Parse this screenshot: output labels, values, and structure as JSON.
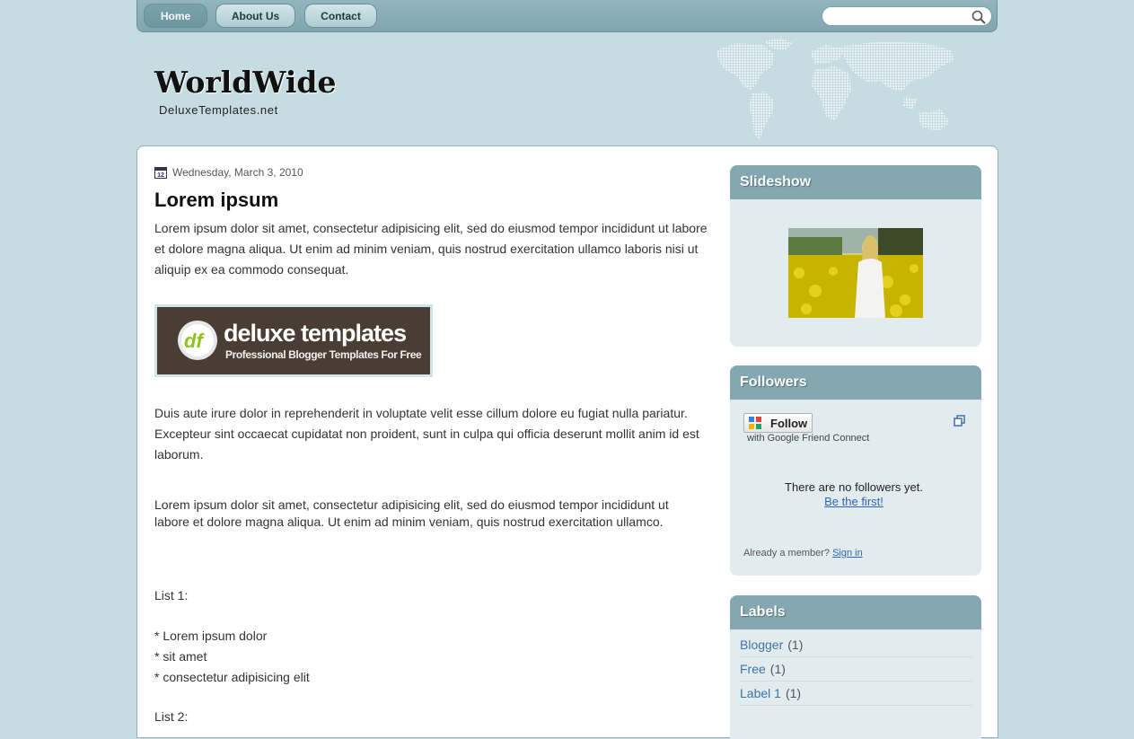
{
  "nav": {
    "items": [
      {
        "label": "Home",
        "active": true
      },
      {
        "label": "About Us",
        "active": false
      },
      {
        "label": "Contact",
        "active": false
      }
    ],
    "search": {
      "placeholder": "",
      "icon": "search-icon"
    }
  },
  "header": {
    "title": "WorldWide",
    "description": "DeluxeTemplates.net"
  },
  "post": {
    "date": "Wednesday, March 3, 2010",
    "date_icon": "calendar-icon",
    "title": "Lorem ipsum",
    "paragraph1": "Lorem ipsum dolor sit amet, consectetur adipisicing elit, sed do eiusmod tempor incididunt ut labore et dolore magna aliqua. Ut enim ad minim veniam, quis nostrud exercitation ullamco laboris nisi ut aliquip ex ea commodo consequat.",
    "banner": {
      "title": "deluxe templates",
      "subtitle": "Professional Blogger Templates For Free"
    },
    "paragraph2": "Duis aute irure dolor in reprehenderit in voluptate velit esse cillum dolore eu fugiat nulla pariatur. Excepteur sint occaecat cupidatat non proident, sunt in culpa qui officia deserunt mollit anim id est laborum.",
    "quote": "Lorem ipsum dolor sit amet, consectetur adipisicing elit, sed do eiusmod tempor incididunt ut labore et dolore magna aliqua. Ut enim ad minim veniam, quis nostrud exercitation ullamco.",
    "list1_title": "List 1:",
    "list1": [
      "* Lorem ipsum dolor",
      "* sit amet",
      "* consectetur adipisicing elit"
    ],
    "list2_title": "List 2:"
  },
  "sidebar": {
    "slideshow": {
      "title": "Slideshow"
    },
    "followers": {
      "title": "Followers",
      "follow_label": "Follow",
      "gfc_text": "with Google Friend Connect",
      "empty_text": "There are no followers yet.",
      "first_link": "Be the first!",
      "member_text": "Already a member?",
      "signin_link": "Sign in"
    },
    "labels": {
      "title": "Labels",
      "items": [
        {
          "name": "Blogger",
          "count": "(1)"
        },
        {
          "name": "Free",
          "count": "(1)"
        },
        {
          "name": "Label 1",
          "count": "(1)"
        }
      ]
    }
  },
  "colors": {
    "background": "#c6dce1",
    "nav_bar": "#85a8b0",
    "widget_header": "#85a8b0",
    "link": "#3e74a8"
  }
}
